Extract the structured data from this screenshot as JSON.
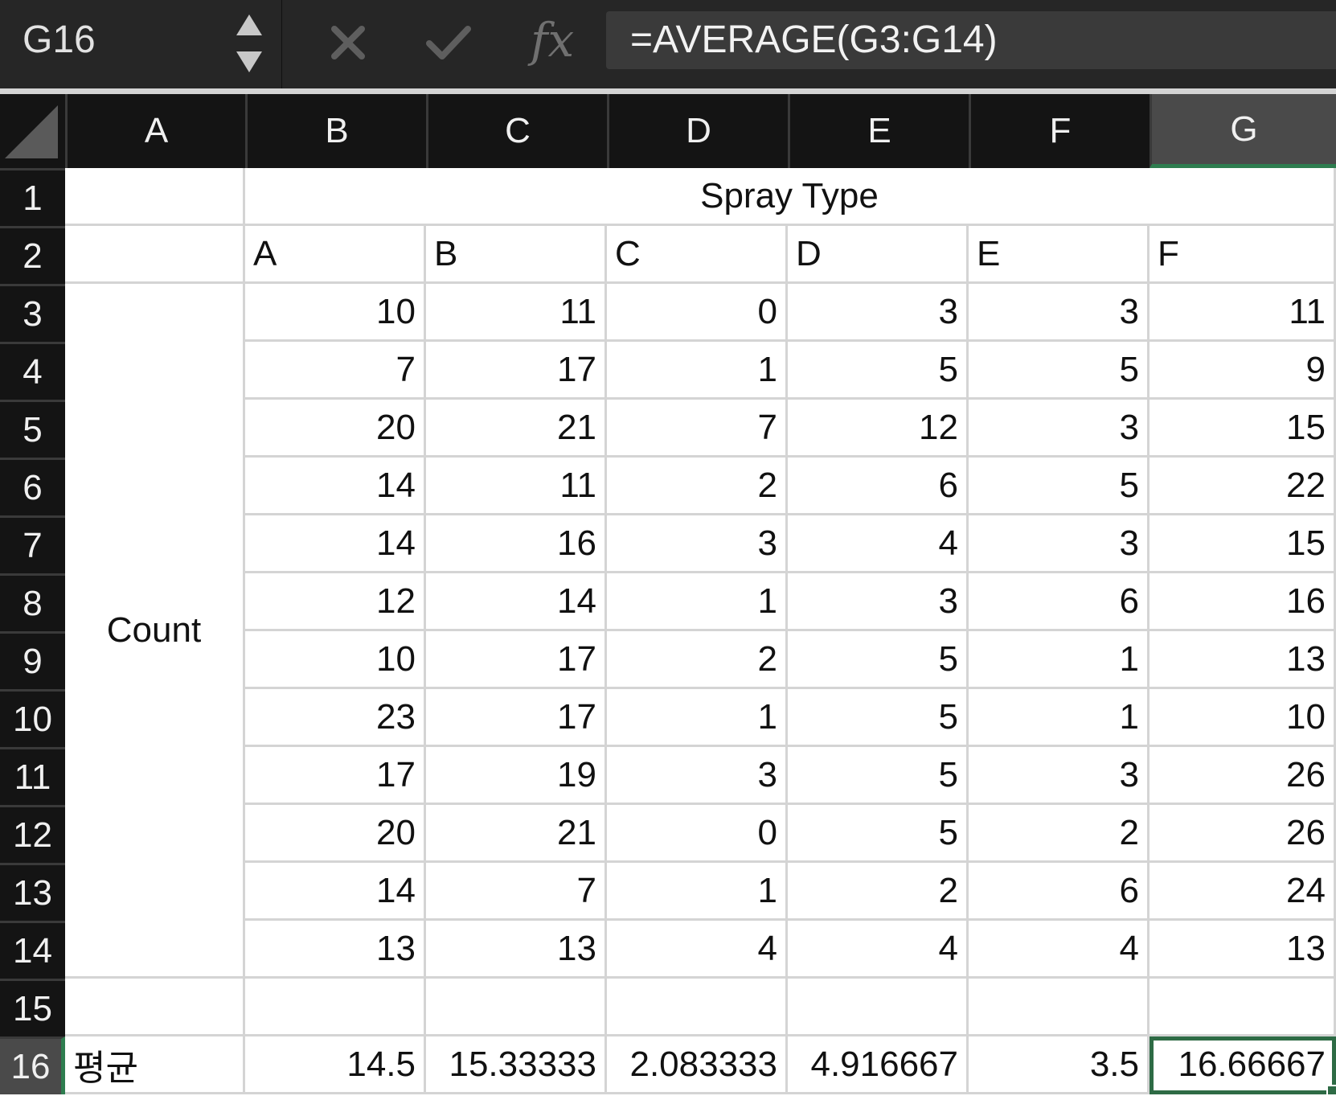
{
  "formula_bar": {
    "name_box": "G16",
    "formula": "=AVERAGE(G3:G14)",
    "fx_label": "fx"
  },
  "column_headers": [
    "A",
    "B",
    "C",
    "D",
    "E",
    "F",
    "G"
  ],
  "row_headers": [
    "1",
    "2",
    "3",
    "4",
    "5",
    "6",
    "7",
    "8",
    "9",
    "10",
    "11",
    "12",
    "13",
    "14",
    "15",
    "16"
  ],
  "active_cell": "G16",
  "sheet": {
    "title": "Spray Type",
    "spray_types": [
      "A",
      "B",
      "C",
      "D",
      "E",
      "F"
    ],
    "count_label": "Count",
    "counts": [
      [
        "10",
        "11",
        "0",
        "3",
        "3",
        "11"
      ],
      [
        "7",
        "17",
        "1",
        "5",
        "5",
        "9"
      ],
      [
        "20",
        "21",
        "7",
        "12",
        "3",
        "15"
      ],
      [
        "14",
        "11",
        "2",
        "6",
        "5",
        "22"
      ],
      [
        "14",
        "16",
        "3",
        "4",
        "3",
        "15"
      ],
      [
        "12",
        "14",
        "1",
        "3",
        "6",
        "16"
      ],
      [
        "10",
        "17",
        "2",
        "5",
        "1",
        "13"
      ],
      [
        "23",
        "17",
        "1",
        "5",
        "1",
        "10"
      ],
      [
        "17",
        "19",
        "3",
        "5",
        "3",
        "26"
      ],
      [
        "20",
        "21",
        "0",
        "5",
        "2",
        "26"
      ],
      [
        "14",
        "7",
        "1",
        "2",
        "6",
        "24"
      ],
      [
        "13",
        "13",
        "4",
        "4",
        "4",
        "13"
      ]
    ],
    "average_label": "평균",
    "averages": [
      "14.5",
      "15.33333",
      "2.083333",
      "4.916667",
      "3.5",
      "16.66667"
    ]
  },
  "colors": {
    "header_bg": "#141414",
    "active_header_bg": "#4a4a4a",
    "selection": "#2e6b45",
    "gridline": "#d4d4d4"
  },
  "icons": [
    "stepper-icon",
    "cancel-icon",
    "enter-icon",
    "fx-icon"
  ]
}
